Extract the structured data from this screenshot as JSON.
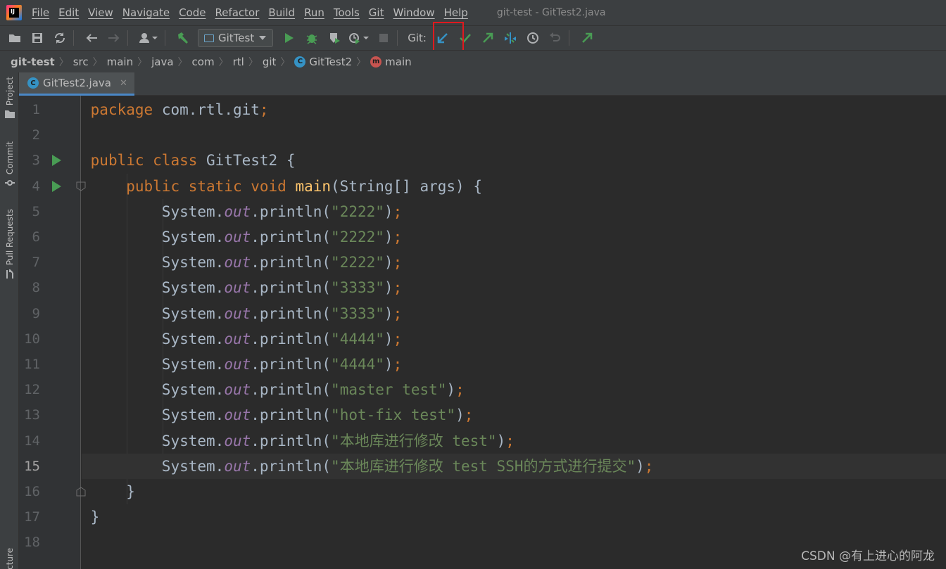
{
  "menubar": {
    "logo_text": "IJ",
    "items": [
      "File",
      "Edit",
      "View",
      "Navigate",
      "Code",
      "Refactor",
      "Build",
      "Run",
      "Tools",
      "Git",
      "Window",
      "Help"
    ],
    "title": "git-test - GitTest2.java"
  },
  "toolbar": {
    "run_config": "GitTest",
    "git_label": "Git:"
  },
  "breadcrumb": {
    "project": "git-test",
    "path": [
      "src",
      "main",
      "java",
      "com",
      "rtl",
      "git"
    ],
    "class_name": "GitTest2",
    "class_icon": "C",
    "method_name": "main",
    "method_icon": "m"
  },
  "left_strip": {
    "project": "Project",
    "commit": "Commit",
    "pull_requests": "Pull Requests",
    "structure": "cture"
  },
  "tab": {
    "label": "GitTest2.java",
    "icon": "C"
  },
  "editor": {
    "current_line": 15,
    "lines": [
      {
        "num": "1",
        "tokens": [
          [
            "kw",
            "package "
          ],
          [
            "pl",
            "com.rtl.git"
          ],
          [
            "punc",
            ";"
          ]
        ]
      },
      {
        "num": "2",
        "tokens": []
      },
      {
        "num": "3",
        "tokens": [
          [
            "kw",
            "public class "
          ],
          [
            "pl",
            "GitTest2 {"
          ]
        ]
      },
      {
        "num": "4",
        "tokens": [
          [
            "pl",
            "    "
          ],
          [
            "kw",
            "public static void "
          ],
          [
            "fn",
            "main"
          ],
          [
            "pl",
            "(String[] args) {"
          ]
        ]
      },
      {
        "num": "5",
        "tokens": [
          [
            "pl",
            "        System."
          ],
          [
            "fld",
            "out"
          ],
          [
            "pl",
            ".println("
          ],
          [
            "st",
            "\"2222\""
          ],
          [
            "pl",
            ")"
          ],
          [
            "punc",
            ";"
          ]
        ]
      },
      {
        "num": "6",
        "tokens": [
          [
            "pl",
            "        System."
          ],
          [
            "fld",
            "out"
          ],
          [
            "pl",
            ".println("
          ],
          [
            "st",
            "\"2222\""
          ],
          [
            "pl",
            ")"
          ],
          [
            "punc",
            ";"
          ]
        ]
      },
      {
        "num": "7",
        "tokens": [
          [
            "pl",
            "        System."
          ],
          [
            "fld",
            "out"
          ],
          [
            "pl",
            ".println("
          ],
          [
            "st",
            "\"2222\""
          ],
          [
            "pl",
            ")"
          ],
          [
            "punc",
            ";"
          ]
        ]
      },
      {
        "num": "8",
        "tokens": [
          [
            "pl",
            "        System."
          ],
          [
            "fld",
            "out"
          ],
          [
            "pl",
            ".println("
          ],
          [
            "st",
            "\"3333\""
          ],
          [
            "pl",
            ")"
          ],
          [
            "punc",
            ";"
          ]
        ]
      },
      {
        "num": "9",
        "tokens": [
          [
            "pl",
            "        System."
          ],
          [
            "fld",
            "out"
          ],
          [
            "pl",
            ".println("
          ],
          [
            "st",
            "\"3333\""
          ],
          [
            "pl",
            ")"
          ],
          [
            "punc",
            ";"
          ]
        ]
      },
      {
        "num": "10",
        "tokens": [
          [
            "pl",
            "        System."
          ],
          [
            "fld",
            "out"
          ],
          [
            "pl",
            ".println("
          ],
          [
            "st",
            "\"4444\""
          ],
          [
            "pl",
            ")"
          ],
          [
            "punc",
            ";"
          ]
        ]
      },
      {
        "num": "11",
        "tokens": [
          [
            "pl",
            "        System."
          ],
          [
            "fld",
            "out"
          ],
          [
            "pl",
            ".println("
          ],
          [
            "st",
            "\"4444\""
          ],
          [
            "pl",
            ")"
          ],
          [
            "punc",
            ";"
          ]
        ]
      },
      {
        "num": "12",
        "tokens": [
          [
            "pl",
            "        System."
          ],
          [
            "fld",
            "out"
          ],
          [
            "pl",
            ".println("
          ],
          [
            "st",
            "\"master test\""
          ],
          [
            "pl",
            ")"
          ],
          [
            "punc",
            ";"
          ]
        ]
      },
      {
        "num": "13",
        "tokens": [
          [
            "pl",
            "        System."
          ],
          [
            "fld",
            "out"
          ],
          [
            "pl",
            ".println("
          ],
          [
            "st",
            "\"hot-fix test\""
          ],
          [
            "pl",
            ")"
          ],
          [
            "punc",
            ";"
          ]
        ]
      },
      {
        "num": "14",
        "tokens": [
          [
            "pl",
            "        System."
          ],
          [
            "fld",
            "out"
          ],
          [
            "pl",
            ".println("
          ],
          [
            "st",
            "\"本地库进行修改 test\""
          ],
          [
            "pl",
            ")"
          ],
          [
            "punc",
            ";"
          ]
        ]
      },
      {
        "num": "15",
        "tokens": [
          [
            "pl",
            "        System."
          ],
          [
            "fld",
            "out"
          ],
          [
            "pl",
            ".println("
          ],
          [
            "st",
            "\"本地库进行修改 test SSH的方式进行提交\""
          ],
          [
            "pl",
            ")"
          ],
          [
            "punc",
            ";"
          ]
        ]
      },
      {
        "num": "16",
        "tokens": [
          [
            "pl",
            "    }"
          ]
        ]
      },
      {
        "num": "17",
        "tokens": [
          [
            "pl",
            "}"
          ]
        ]
      },
      {
        "num": "18",
        "tokens": []
      }
    ]
  },
  "watermark": "CSDN @有上进心的阿龙",
  "colors": {
    "keyword": "#cc7832",
    "string": "#6a8759",
    "method": "#ffc66d",
    "field": "#9876aa",
    "plain": "#a9b7c6",
    "highlight_box": "#e0191e",
    "git_update": "#3592c4",
    "git_commit": "#499c54"
  }
}
